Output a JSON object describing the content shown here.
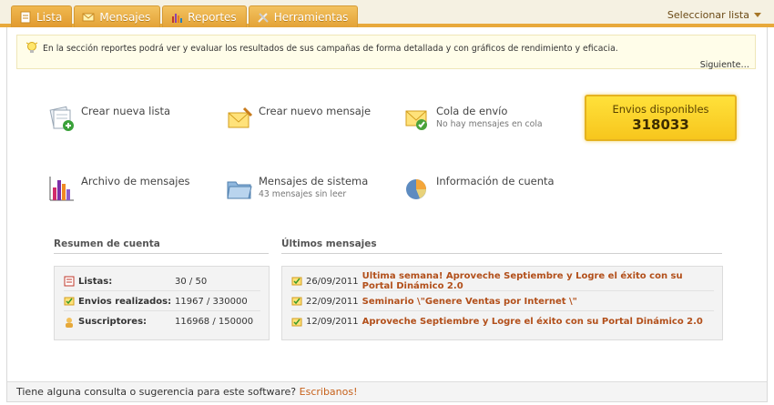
{
  "tabs": [
    {
      "label": "Lista",
      "icon": "document-icon"
    },
    {
      "label": "Mensajes",
      "icon": "envelope-icon"
    },
    {
      "label": "Reportes",
      "icon": "bar-chart-icon"
    },
    {
      "label": "Herramientas",
      "icon": "tools-icon"
    }
  ],
  "select_list_label": "Seleccionar lista",
  "info": {
    "text": "En la sección reportes podrá ver y evaluar los resultados de sus campañas de forma detallada y con gráficos de rendimiento y eficacia.",
    "next_label": "Siguiente…"
  },
  "actions": {
    "new_list": {
      "title": "Crear nueva lista"
    },
    "new_message": {
      "title": "Crear nuevo mensaje"
    },
    "queue": {
      "title": "Cola de envío",
      "subtitle": "No hay mensajes en cola"
    },
    "archive": {
      "title": "Archivo de mensajes"
    },
    "system": {
      "title": "Mensajes de sistema",
      "subtitle": "43 mensajes sin leer"
    },
    "account": {
      "title": "Información de cuenta"
    }
  },
  "envios": {
    "title": "Envios disponibles",
    "value": "318033"
  },
  "summary": {
    "heading": "Resumen de cuenta",
    "rows": [
      {
        "label": "Listas:",
        "value": "30 / 50"
      },
      {
        "label": "Envios realizados:",
        "value": "11967 / 330000"
      },
      {
        "label": "Suscriptores:",
        "value": "116968 / 150000"
      }
    ]
  },
  "messages": {
    "heading": "Últimos mensajes",
    "rows": [
      {
        "date": "26/09/2011",
        "title": "Ultima semana! Aproveche Septiembre y Logre el éxito con su Portal Dinámico 2.0"
      },
      {
        "date": "22/09/2011",
        "title": "Seminario \\\"Genere Ventas por Internet \\\""
      },
      {
        "date": "12/09/2011",
        "title": "Aproveche Septiembre y Logre el éxito con su Portal Dinámico 2.0"
      }
    ]
  },
  "footer": {
    "text": "Tiene alguna consulta o sugerencia para este software?",
    "link": "Escribanos!"
  },
  "colors": {
    "accent": "#e8a93b",
    "link": "#b24f1a",
    "highlight": "#ffd72a"
  }
}
